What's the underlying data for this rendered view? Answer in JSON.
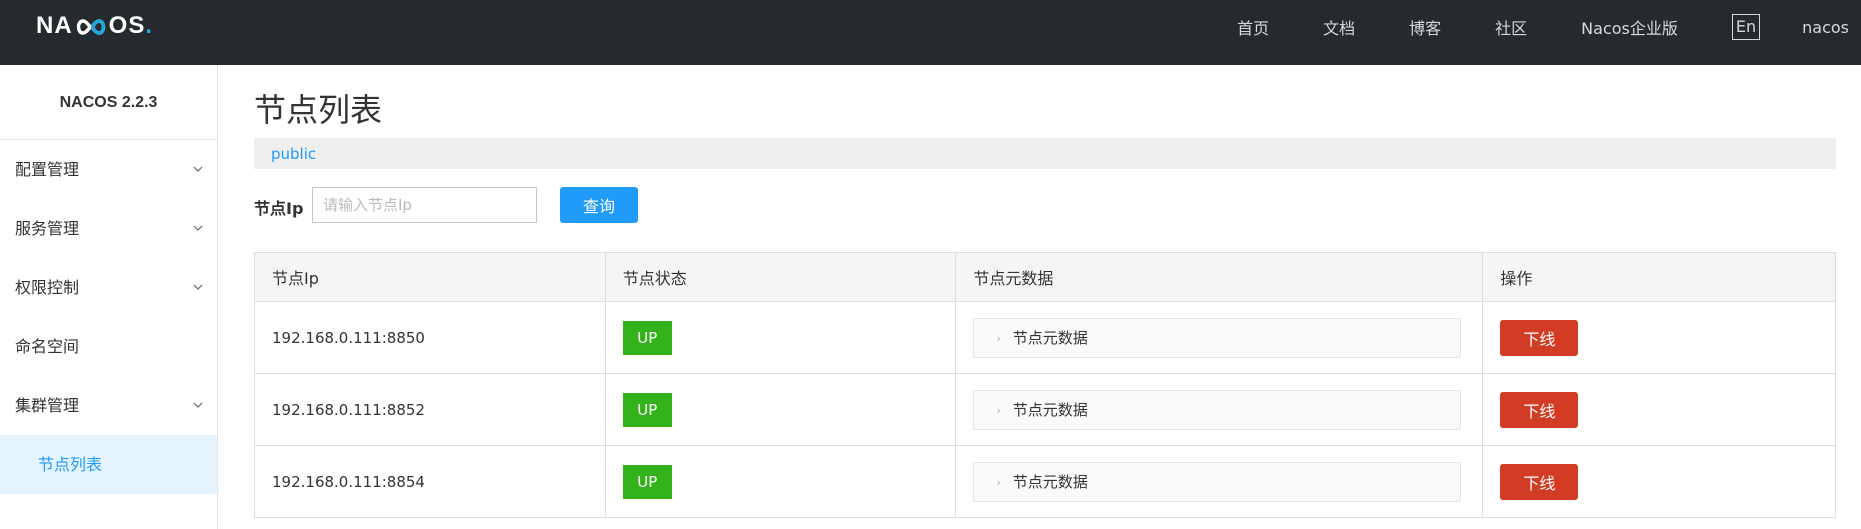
{
  "header": {
    "logo": {
      "left": "NA",
      "right": "OS",
      "dot": "."
    },
    "nav": [
      "首页",
      "文档",
      "博客",
      "社区",
      "Nacos企业版"
    ],
    "lang": "En",
    "user": "nacos"
  },
  "sidebar": {
    "version": "NACOS 2.2.3",
    "items": [
      {
        "label": "配置管理",
        "expandable": true
      },
      {
        "label": "服务管理",
        "expandable": true
      },
      {
        "label": "权限控制",
        "expandable": true
      },
      {
        "label": "命名空间",
        "expandable": false
      },
      {
        "label": "集群管理",
        "expandable": true
      }
    ],
    "active_sub": "节点列表"
  },
  "main": {
    "title": "节点列表",
    "namespace": "public",
    "search": {
      "label": "节点Ip",
      "placeholder": "请输入节点Ip",
      "value": "",
      "button": "查询"
    },
    "table": {
      "columns": [
        "节点Ip",
        "节点状态",
        "节点元数据",
        "操作"
      ],
      "rows": [
        {
          "ip": "192.168.0.111:8850",
          "state": "UP",
          "meta": "节点元数据",
          "action": "下线"
        },
        {
          "ip": "192.168.0.111:8852",
          "state": "UP",
          "meta": "节点元数据",
          "action": "下线"
        },
        {
          "ip": "192.168.0.111:8854",
          "state": "UP",
          "meta": "节点元数据",
          "action": "下线"
        }
      ]
    }
  },
  "colors": {
    "topbar_bg": "#252a2f",
    "accent": "#209bfa",
    "status_up": "#34b21c",
    "danger": "#d23c25",
    "active_menu_bg": "#e4f3fe"
  }
}
